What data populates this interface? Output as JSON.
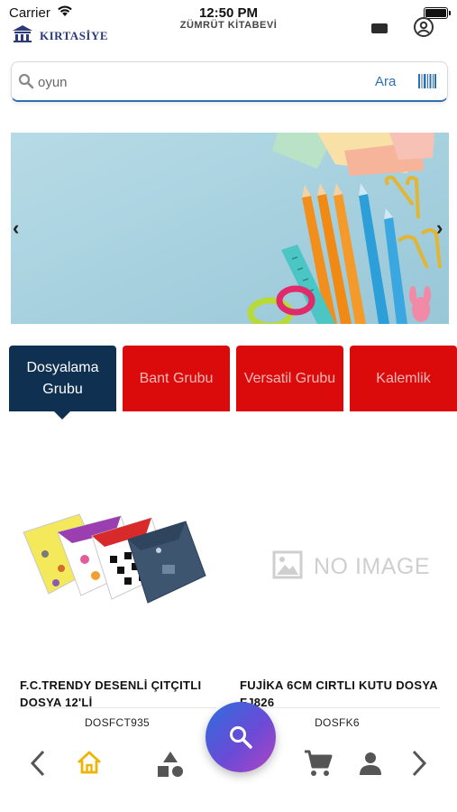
{
  "status_bar": {
    "carrier": "Carrier",
    "time": "12:50 PM"
  },
  "header": {
    "logo_text": "KIRTASİYE",
    "store_name": "ZÜMRÜT KİTABEVİ"
  },
  "search": {
    "value": "oyun",
    "button_label": "Ara"
  },
  "categories": [
    {
      "label": "Dosyalama Grubu",
      "active": true
    },
    {
      "label": "Bant Grubu",
      "active": false
    },
    {
      "label": "Versatil Grubu",
      "active": false
    },
    {
      "label": "Kalemlik",
      "active": false
    }
  ],
  "products": [
    {
      "name": "F.C.TRENDY DESENLİ ÇITÇITLI DOSYA 12'Lİ",
      "code": "DOSFCT935",
      "image": "folders-photo"
    },
    {
      "name": "FUJİKA 6CM CIRTLI KUTU DOSYA FJ826",
      "code": "DOSFK6",
      "image": "no-image-placeholder",
      "image_placeholder": "NO IMAGE"
    }
  ],
  "bottom_nav": {
    "items": [
      "chevron-left-icon",
      "home-icon",
      "categories-icon",
      "search-icon",
      "cart-icon",
      "user-icon",
      "chevron-right-icon"
    ],
    "active": "home-icon"
  },
  "colors": {
    "active_tab": "#0f3050",
    "inactive_tab": "#dc0b0b",
    "accent": "#2f6fb3",
    "home_active": "#f0b400"
  }
}
